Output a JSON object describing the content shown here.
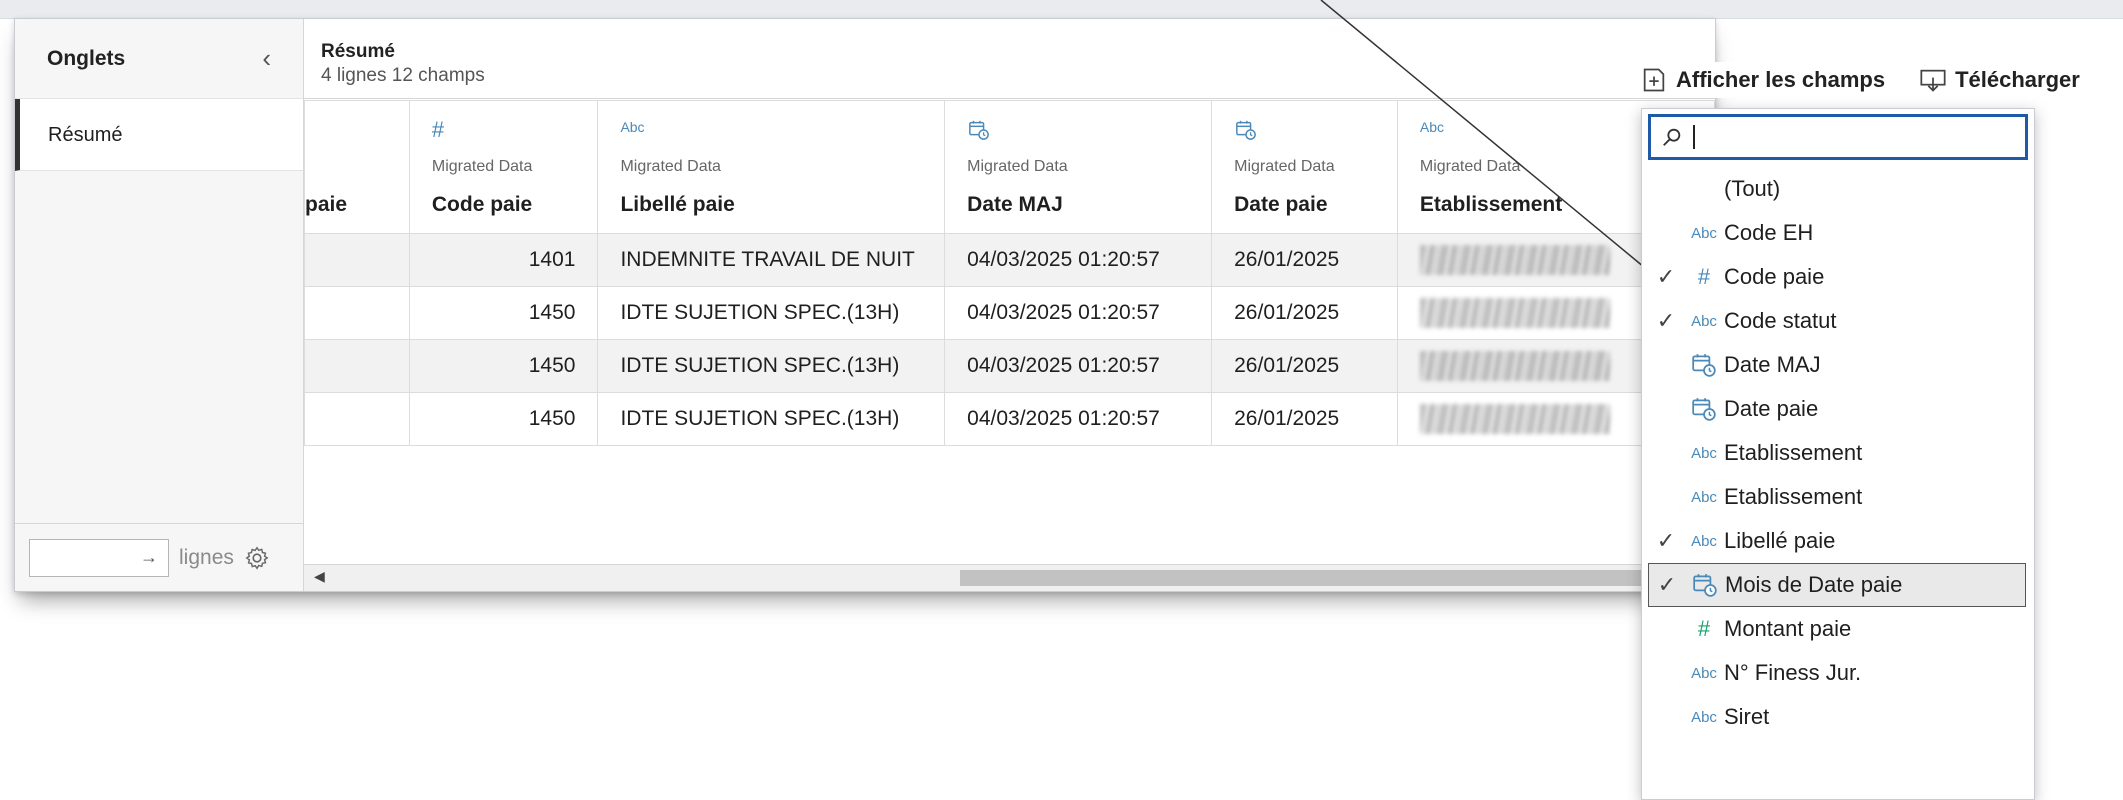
{
  "sidebar": {
    "title": "Onglets",
    "collapse_glyph": "‹",
    "tabs": [
      {
        "label": "Résumé"
      }
    ],
    "rows_input_value": "→",
    "rows_label": "lignes"
  },
  "summary": {
    "title": "Résumé",
    "subtitle": "4 lignes 12 champs"
  },
  "table": {
    "columns": [
      {
        "icon": "",
        "source": "",
        "name": "paie"
      },
      {
        "icon": "number-icon",
        "source": "Migrated Data",
        "name": "Code paie"
      },
      {
        "icon": "string-icon",
        "source": "Migrated Data",
        "name": "Libellé paie"
      },
      {
        "icon": "datetime-icon",
        "source": "Migrated Data",
        "name": "Date MAJ"
      },
      {
        "icon": "datetime-icon",
        "source": "Migrated Data",
        "name": "Date paie"
      },
      {
        "icon": "string-icon",
        "source": "Migrated Data",
        "name": "Etablissement"
      }
    ],
    "rows": [
      {
        "code": "1401",
        "libelle": "INDEMNITE TRAVAIL DE NUIT",
        "date_maj": "04/03/2025 01:20:57",
        "date_paie": "26/01/2025"
      },
      {
        "code": "1450",
        "libelle": "IDTE SUJETION SPEC.(13H)",
        "date_maj": "04/03/2025 01:20:57",
        "date_paie": "26/01/2025"
      },
      {
        "code": "1450",
        "libelle": "IDTE SUJETION SPEC.(13H)",
        "date_maj": "04/03/2025 01:20:57",
        "date_paie": "26/01/2025"
      },
      {
        "code": "1450",
        "libelle": "IDTE SUJETION SPEC.(13H)",
        "date_maj": "04/03/2025 01:20:57",
        "date_paie": "26/01/2025"
      }
    ]
  },
  "toolbar": {
    "show_fields_label": "Afficher les champs",
    "download_label": "Télécharger"
  },
  "field_picker": {
    "search_value": "",
    "options": [
      {
        "label": "(Tout)",
        "icon": "",
        "checked": false,
        "selected": false
      },
      {
        "label": "Code EH",
        "icon": "Abc",
        "checked": false,
        "selected": false
      },
      {
        "label": "Code paie",
        "icon": "#",
        "checked": true,
        "selected": false
      },
      {
        "label": "Code statut",
        "icon": "Abc",
        "checked": true,
        "selected": false
      },
      {
        "label": "Date MAJ",
        "icon": "datetime",
        "checked": false,
        "selected": false
      },
      {
        "label": "Date paie",
        "icon": "datetime",
        "checked": false,
        "selected": false
      },
      {
        "label": "Etablissement",
        "icon": "Abc",
        "checked": false,
        "selected": false
      },
      {
        "label": "Etablissement",
        "icon": "Abc",
        "checked": false,
        "selected": false
      },
      {
        "label": "Libellé paie",
        "icon": "Abc",
        "checked": true,
        "selected": false
      },
      {
        "label": "Mois de Date paie",
        "icon": "datetime",
        "checked": true,
        "selected": true
      },
      {
        "label": "Montant paie",
        "icon": "#green",
        "checked": false,
        "selected": false
      },
      {
        "label": "N° Finess Jur.",
        "icon": "Abc",
        "checked": false,
        "selected": false
      },
      {
        "label": "Siret",
        "icon": "Abc",
        "checked": false,
        "selected": false
      }
    ],
    "check_glyph": "✓",
    "abc_label": "Abc",
    "hash_glyph": "#"
  },
  "colors": {
    "accent_blue": "#1f5aa8",
    "type_icon_blue": "#4a89b8",
    "measure_green": "#1aa36b"
  }
}
